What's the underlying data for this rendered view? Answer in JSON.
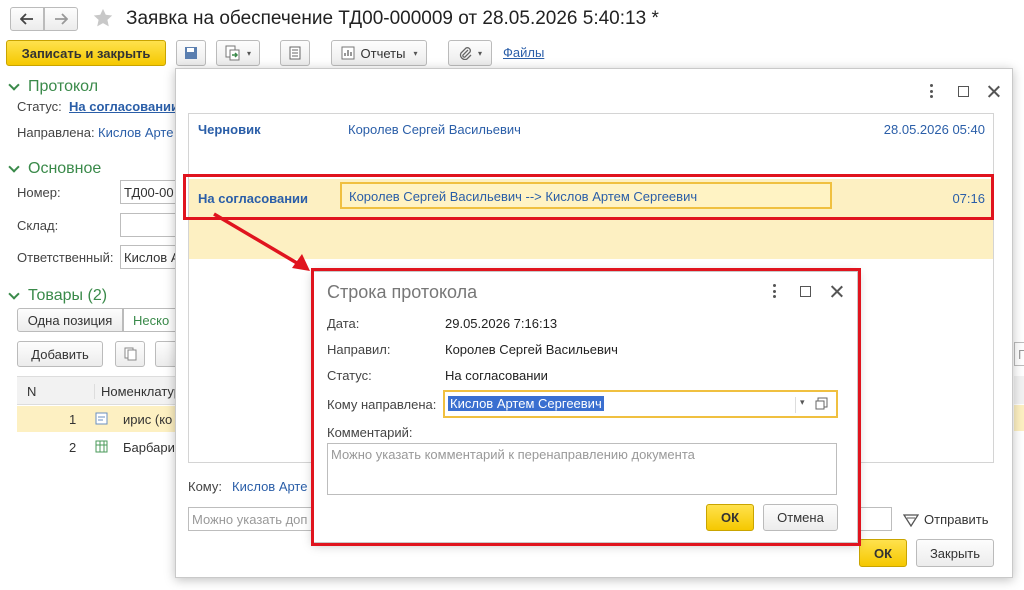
{
  "window": {
    "title": "Заявка на обеспечение ТД00-000009 от 28.05.2026 5:40:13 *"
  },
  "toolbar": {
    "save_close": "Записать и закрыть",
    "reports": "Отчеты",
    "files": "Файлы"
  },
  "protocol": {
    "heading": "Протокол",
    "status_label": "Статус:",
    "status_value": "На согласовании",
    "sent_label": "Направлена:",
    "sent_value": "Кислов Арте"
  },
  "main": {
    "heading": "Основное",
    "number_label": "Номер:",
    "number_value": "ТД00-00",
    "warehouse_label": "Склад:",
    "responsible_label": "Ответственный:",
    "responsible_value": "Кислов А"
  },
  "goods": {
    "heading": "Товары (2)",
    "tab_one": "Одна позиция",
    "tab_many": "Неско",
    "add_button": "Добавить",
    "col_n": "N",
    "col_item": "Номенклатур",
    "rows": [
      {
        "n": "1",
        "name": "ирис (ко"
      },
      {
        "n": "2",
        "name": "Барбари"
      }
    ],
    "right_search_fragment": "П"
  },
  "history": {
    "rows": [
      {
        "status": "Черновик",
        "route": "Королев Сергей Васильевич",
        "time": "28.05.2026 05:40"
      },
      {
        "status": "На согласовании",
        "route": "Королев Сергей Васильевич --> Кислов Артем Сергеевич",
        "time": "07:16"
      }
    ],
    "to_label": "Кому:",
    "to_value": "Кислов Арте",
    "comment_placeholder": "Можно указать доп",
    "send_button": "Отправить",
    "ok_button": "ОК",
    "close_button": "Закрыть"
  },
  "row_dialog": {
    "title": "Строка протокола",
    "date_label": "Дата:",
    "date_value": "29.05.2026 7:16:13",
    "from_label": "Направил:",
    "from_value": "Королев Сергей Васильевич",
    "status_label": "Статус:",
    "status_value": "На согласовании",
    "to_label": "Кому направлена:",
    "to_value": "Кислов Артем Сергеевич",
    "comment_label": "Комментарий:",
    "comment_placeholder": "Можно указать комментарий к перенаправлению документа",
    "ok_button": "ОК",
    "cancel_button": "Отмена"
  },
  "colors": {
    "accent_yellow": "#f5c800",
    "highlight_row": "#fdf0c2",
    "red_frame": "#e0141e",
    "link": "#2a5ea8",
    "section_green": "#3a8a4a"
  }
}
